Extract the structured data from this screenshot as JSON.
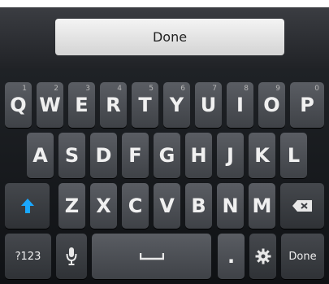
{
  "done_bar": {
    "label": "Done"
  },
  "rows": {
    "r1": [
      {
        "label": "Q",
        "hint": "1"
      },
      {
        "label": "W",
        "hint": "2"
      },
      {
        "label": "E",
        "hint": "3"
      },
      {
        "label": "R",
        "hint": "4"
      },
      {
        "label": "T",
        "hint": "5"
      },
      {
        "label": "Y",
        "hint": "6"
      },
      {
        "label": "U",
        "hint": "7"
      },
      {
        "label": "I",
        "hint": "8"
      },
      {
        "label": "O",
        "hint": "9"
      },
      {
        "label": "P",
        "hint": "0"
      }
    ],
    "r2": [
      "A",
      "S",
      "D",
      "F",
      "G",
      "H",
      "J",
      "K",
      "L"
    ],
    "r3": [
      "Z",
      "X",
      "C",
      "V",
      "B",
      "N",
      "M"
    ]
  },
  "func": {
    "symbols_label": "?123",
    "period_label": ".",
    "done_label": "Done",
    "shift_color": "#1aa8ff"
  },
  "icons": {
    "shift": "shift-arrow-icon",
    "delete": "backspace-icon",
    "mic": "microphone-icon",
    "space": "space-bar-icon",
    "settings": "gear-icon"
  }
}
